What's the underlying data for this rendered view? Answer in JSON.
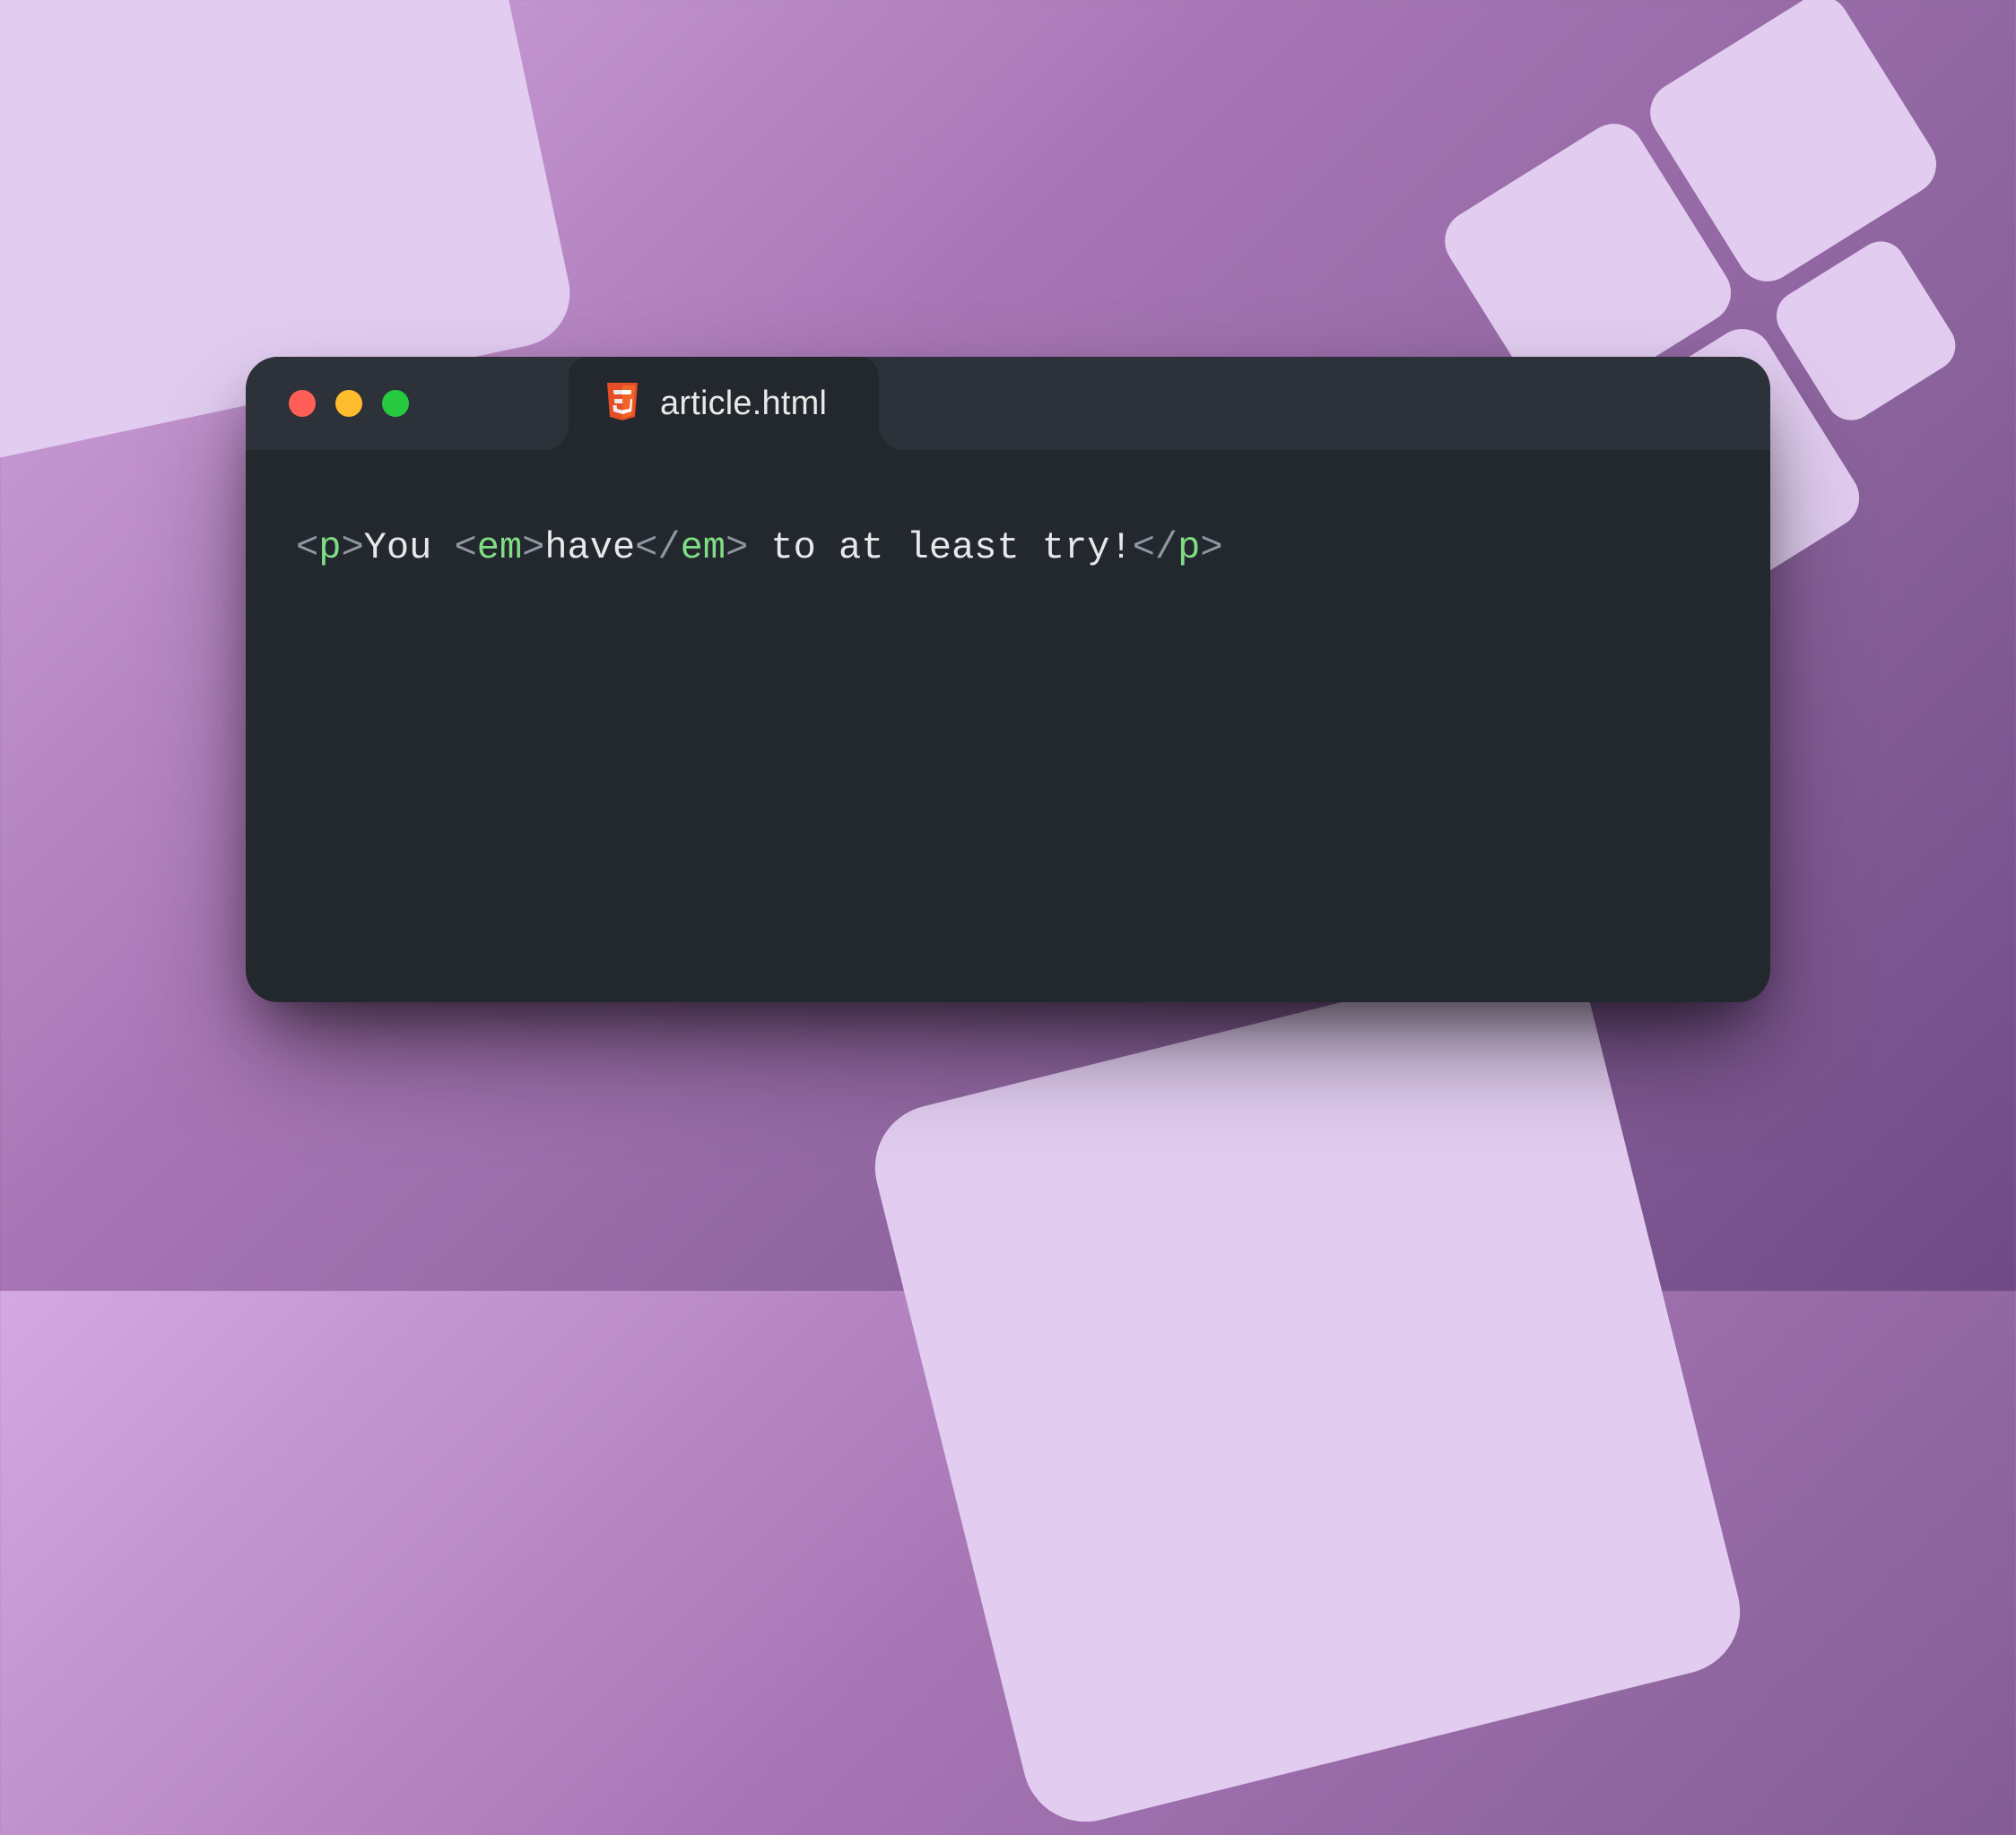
{
  "tab": {
    "filename": "article.html",
    "file_icon": "html5-icon"
  },
  "window": {
    "buttons": [
      "close",
      "minimize",
      "zoom"
    ]
  },
  "code": {
    "tokens": [
      {
        "t": "punct",
        "v": "<"
      },
      {
        "t": "tag",
        "v": "p"
      },
      {
        "t": "punct",
        "v": ">"
      },
      {
        "t": "text",
        "v": "You "
      },
      {
        "t": "punct",
        "v": "<"
      },
      {
        "t": "tag",
        "v": "em"
      },
      {
        "t": "punct",
        "v": ">"
      },
      {
        "t": "text",
        "v": "have"
      },
      {
        "t": "punct",
        "v": "</"
      },
      {
        "t": "tag",
        "v": "em"
      },
      {
        "t": "punct",
        "v": ">"
      },
      {
        "t": "text",
        "v": " to at least try!"
      },
      {
        "t": "punct",
        "v": "</"
      },
      {
        "t": "tag",
        "v": "p"
      },
      {
        "t": "punct",
        "v": ">"
      }
    ]
  },
  "colors": {
    "editor_bg": "#23272e",
    "titlebar_bg": "#2d323a",
    "tag": "#7fdd84",
    "punct": "#8f97a3",
    "text": "#e6e8ea"
  }
}
